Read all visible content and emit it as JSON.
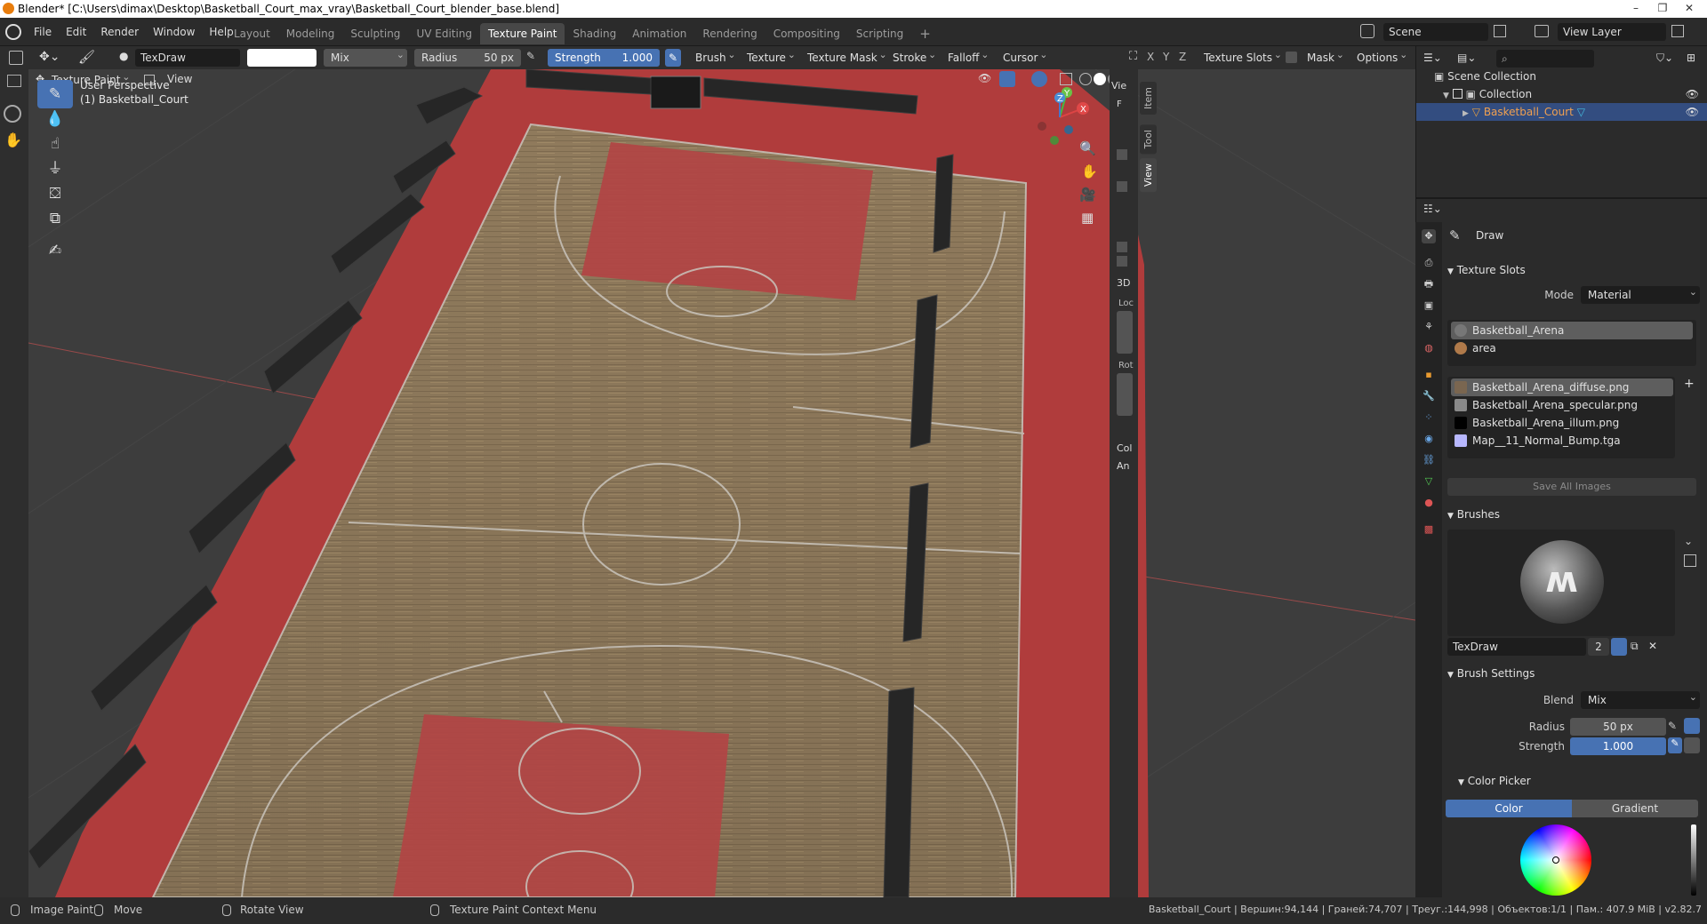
{
  "window": {
    "title": "Blender* [C:\\Users\\dimax\\Desktop\\Basketball_Court_max_vray\\Basketball_Court_blender_base.blend]",
    "minimize": "–",
    "maximize": "❐",
    "close": "✕"
  },
  "menu": [
    "File",
    "Edit",
    "Render",
    "Window",
    "Help"
  ],
  "workspaces": [
    "Layout",
    "Modeling",
    "Sculpting",
    "UV Editing",
    "Texture Paint",
    "Shading",
    "Animation",
    "Rendering",
    "Compositing",
    "Scripting"
  ],
  "active_workspace": "Texture Paint",
  "add_workspace": "+",
  "scene": {
    "label": "Scene",
    "view_layer": "View Layer"
  },
  "toolheader": {
    "brush_name": "TexDraw",
    "blend": "Mix",
    "radius_label": "Radius",
    "radius_value": "50 px",
    "strength_label": "Strength",
    "strength_value": "1.000",
    "strength_fraction": 1.0,
    "menus": [
      "Brush",
      "Texture",
      "Texture Mask",
      "Stroke",
      "Falloff",
      "Cursor"
    ],
    "axes": [
      "X",
      "Y",
      "Z"
    ],
    "texture_slots": "Texture Slots",
    "mask": "Mask",
    "options": "Options"
  },
  "viewport_header": {
    "mode": "Texture Paint",
    "view": "View"
  },
  "viewport": {
    "perspective": "User Perspective",
    "object": "(1) Basketball_Court",
    "gizmo": {
      "x": "X",
      "y": "Y",
      "z": "Z"
    }
  },
  "sidebar_tabs": [
    "Item",
    "Tool",
    "View"
  ],
  "sidebar": {
    "view": "Vie",
    "f_label": "F",
    "cursor": "3D",
    "loc": "Loc",
    "rot": "Rot",
    "col": "Col",
    "an": "An"
  },
  "outliner": {
    "search_placeholder": "",
    "root": "Scene Collection",
    "collection": "Collection",
    "object": "Basketball_Court"
  },
  "properties": {
    "tool_title": "Draw",
    "texture_slots": {
      "title": "Texture Slots",
      "mode_label": "Mode",
      "mode_value": "Material",
      "materials": [
        "Basketball_Arena",
        "area"
      ],
      "images": [
        {
          "name": "Basketball_Arena_diffuse.png",
          "color": "#7a6650"
        },
        {
          "name": "Basketball_Arena_specular.png",
          "color": "#8a8a8a"
        },
        {
          "name": "Basketball_Arena_illum.png",
          "color": "#000000"
        },
        {
          "name": "Map__11_Normal_Bump.tga",
          "color": "#b8b8ff"
        }
      ],
      "save_all": "Save All Images"
    },
    "brushes": {
      "title": "Brushes",
      "name": "TexDraw",
      "users": "2"
    },
    "brush_settings": {
      "title": "Brush Settings",
      "blend_label": "Blend",
      "blend_value": "Mix",
      "radius_label": "Radius",
      "radius_value": "50 px",
      "strength_label": "Strength",
      "strength_value": "1.000"
    },
    "color_picker": {
      "title": "Color Picker",
      "tab_color": "Color",
      "tab_gradient": "Gradient"
    }
  },
  "status": {
    "items": [
      "Image Paint",
      "Move",
      "Rotate View",
      "Texture Paint Context Menu"
    ],
    "stats": "Basketball_Court | Вершин:94,144 | Граней:74,707 | Треуг.:144,998 | Объектов:1/1 | Пам.: 407.9 MiB | v2.82.7"
  },
  "colors": {
    "accent": "#4772b3",
    "selection": "#334d80",
    "court_red": "#b03c3c",
    "court_wood": "#8f7a5c"
  }
}
